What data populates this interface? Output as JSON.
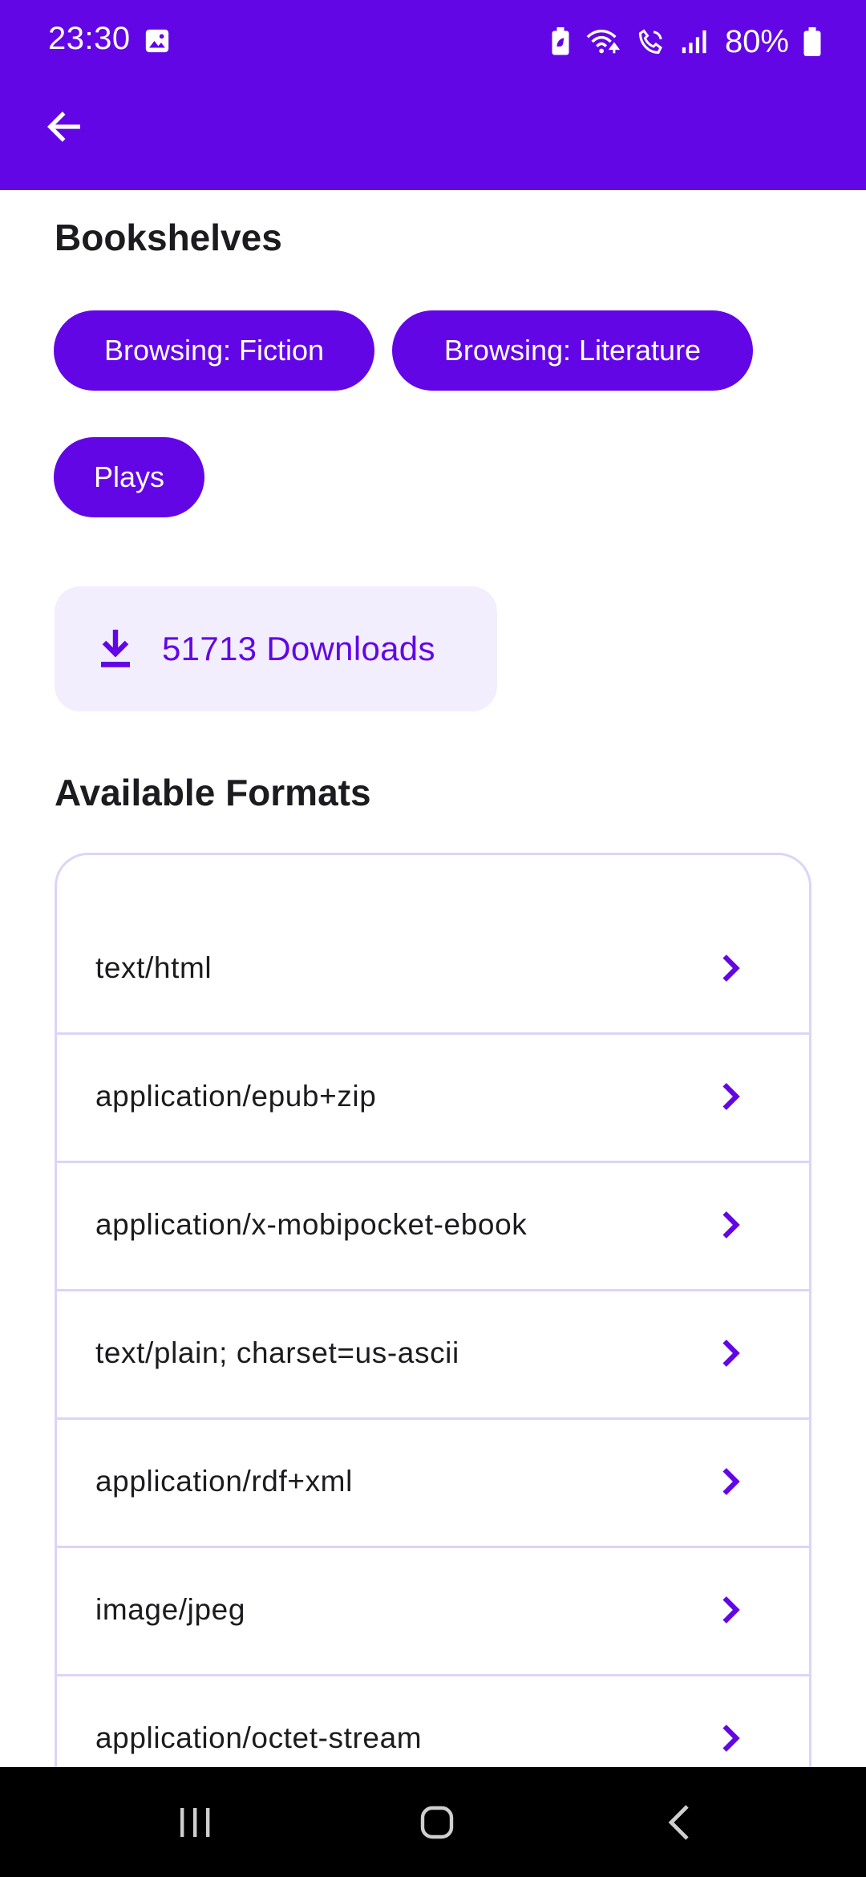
{
  "status_bar": {
    "time": "23:30",
    "battery": "80%",
    "icons": [
      "image-icon",
      "battery-saver-icon",
      "wifi-calling-icon",
      "call-icon",
      "signal-icon",
      "battery-icon"
    ]
  },
  "app_bar": {
    "back_icon": "arrow-back-icon"
  },
  "bookshelves": {
    "title": "Bookshelves",
    "chips": [
      "Browsing: Fiction",
      "Browsing: Literature",
      "Plays"
    ]
  },
  "downloads": {
    "label": "51713 Downloads",
    "icon": "download-icon"
  },
  "formats": {
    "title": "Available Formats",
    "items": [
      "text/html",
      "application/epub+zip",
      "application/x-mobipocket-ebook",
      "text/plain; charset=us-ascii",
      "application/rdf+xml",
      "image/jpeg",
      "application/octet-stream"
    ]
  },
  "nav_bar": {
    "buttons": [
      "recents-icon",
      "home-icon",
      "back-icon"
    ]
  },
  "colors": {
    "primary": "#6206e6",
    "surface_tint": "#f3eefe",
    "outline": "#ddd4f8"
  }
}
